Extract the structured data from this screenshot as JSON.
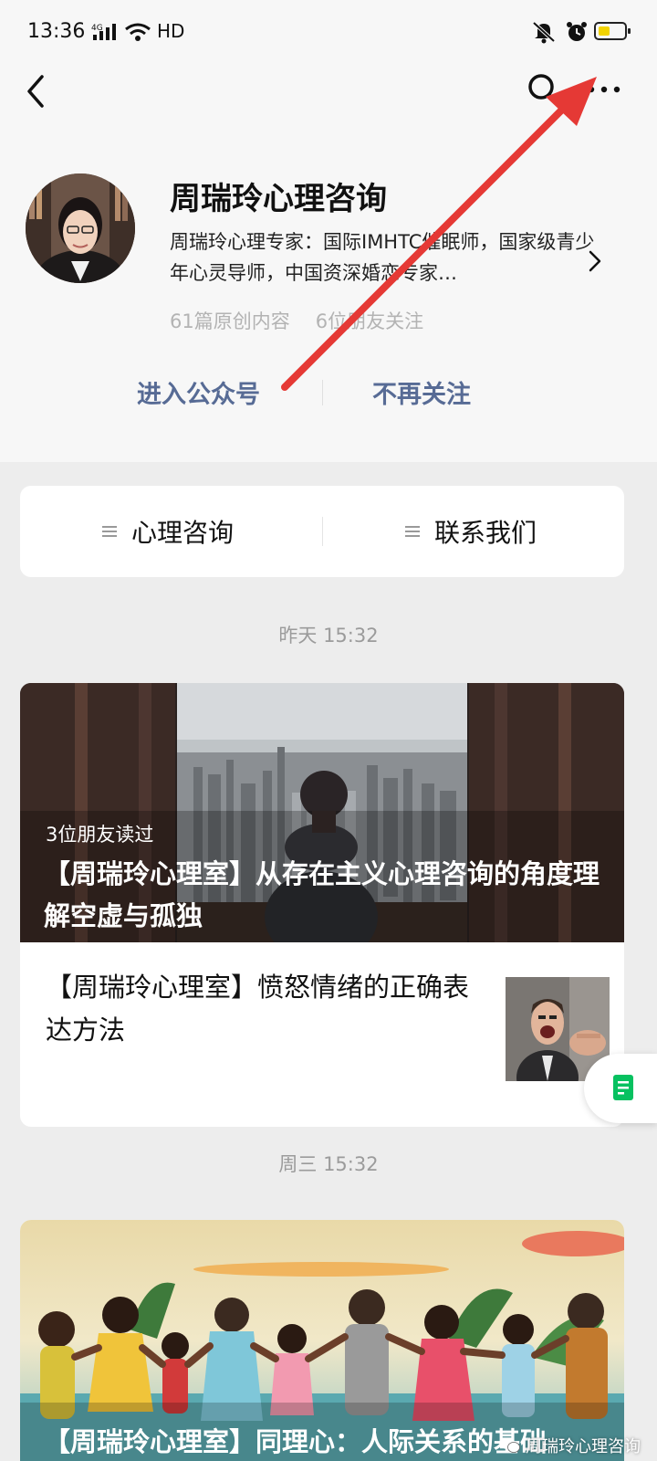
{
  "status_bar": {
    "time": "13:36",
    "network": "4G",
    "hd": "HD"
  },
  "nav": {
    "back_icon": "chevron-left-icon",
    "search_icon": "search-icon",
    "more_icon": "more-dots-icon"
  },
  "profile": {
    "name": "周瑞玲心理咨询",
    "intro": "周瑞玲心理专家：国际IMHTC催眠师，国家级青少年心灵导师，中国资深婚恋专家…",
    "original_count": "61篇原创内容",
    "friends_follow": "6位朋友关注"
  },
  "actions": {
    "enter": "进入公众号",
    "unfollow": "不再关注"
  },
  "menu": {
    "items": [
      "心理咨询",
      "联系我们"
    ]
  },
  "feed": {
    "date1": "昨天 15:32",
    "article1": {
      "read_by": "3位朋友读过",
      "title": "【周瑞玲心理室】从存在主义心理咨询的角度理解空虚与孤独"
    },
    "article2": {
      "title": "【周瑞玲心理室】愤怒情绪的正确表达方法"
    },
    "date2": "周三 15:32",
    "article3": {
      "title": "【周瑞玲心理室】同理心：人际关系的基础"
    }
  },
  "watermark": "周瑞玲心理咨询",
  "colors": {
    "link_blue": "#576b95",
    "annotation_red": "#e53935",
    "wechat_green": "#07c160"
  }
}
